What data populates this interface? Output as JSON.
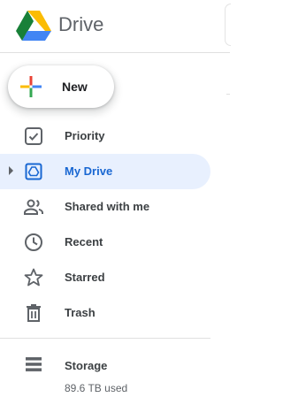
{
  "header": {
    "title": "Drive"
  },
  "new_button": {
    "label": "New"
  },
  "nav": {
    "items": [
      {
        "label": "Priority",
        "icon": "priority-icon"
      },
      {
        "label": "My Drive",
        "icon": "my-drive-icon"
      },
      {
        "label": "Shared with me",
        "icon": "shared-with-me-icon"
      },
      {
        "label": "Recent",
        "icon": "recent-clock-icon"
      },
      {
        "label": "Starred",
        "icon": "star-icon"
      },
      {
        "label": "Trash",
        "icon": "trash-icon"
      }
    ]
  },
  "storage": {
    "label": "Storage",
    "used": "89.6 TB used"
  },
  "colors": {
    "active_bg": "#e8f0fe",
    "active_text": "#1967d2",
    "google_blue": "#4285f4",
    "google_red": "#ea4335",
    "google_yellow": "#fbbc04",
    "google_green": "#34a853"
  }
}
